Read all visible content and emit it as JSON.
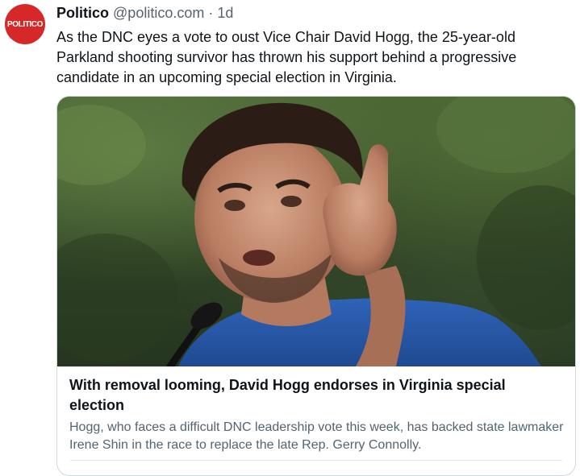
{
  "tweet": {
    "avatar_text": "POLITICO",
    "author_name": "Politico",
    "handle": "@politico.com",
    "separator": "·",
    "time": "1d",
    "text": "As the DNC eyes a vote to oust Vice Chair David Hogg, the 25-year-old Parkland shooting survivor has thrown his support behind a progressive candidate in an upcoming special election in Virginia."
  },
  "card": {
    "image_icon": "news-photo-image",
    "title": "With removal looming, David Hogg endorses in Virginia special election",
    "description": "Hogg, who faces a difficult DNC leadership vote this week, has backed state lawmaker Irene Shin in the race to replace the late Rep. Gerry Connolly."
  },
  "colors": {
    "avatar_bg": "#d62828",
    "muted_text": "#536471",
    "primary_text": "#0f1419",
    "border": "#cfd9de"
  }
}
